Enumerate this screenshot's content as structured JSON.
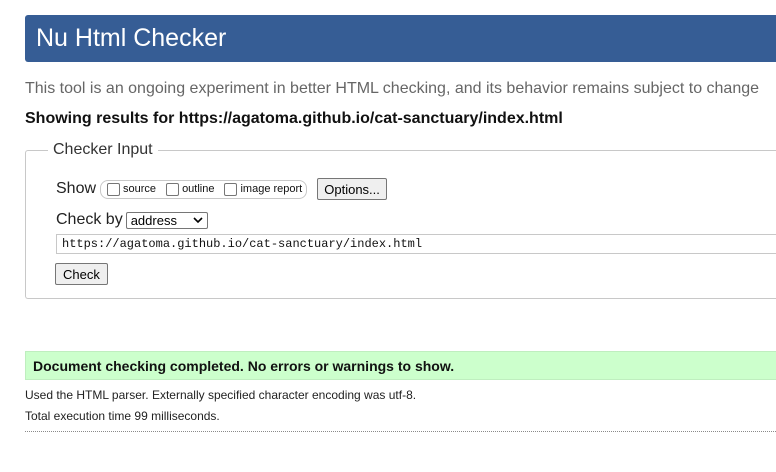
{
  "header": {
    "title": "Nu Html Checker"
  },
  "tagline": "This tool is an ongoing experiment in better HTML checking, and its behavior remains subject to change",
  "results_heading": "Showing results for https://agatoma.github.io/cat-sanctuary/index.html",
  "checker_input": {
    "legend": "Checker Input",
    "show_label": "Show",
    "show_options": [
      {
        "label": "source",
        "checked": false
      },
      {
        "label": "outline",
        "checked": false
      },
      {
        "label": "image report",
        "checked": false
      }
    ],
    "options_button": "Options...",
    "check_by_label": "Check by",
    "check_by_value": "address",
    "url_value": "https://agatoma.github.io/cat-sanctuary/index.html",
    "check_button": "Check"
  },
  "result": {
    "success_message": "Document checking completed. No errors or warnings to show.",
    "parser_info": "Used the HTML parser. Externally specified character encoding was utf-8.",
    "execution_time": "Total execution time 99 milliseconds."
  },
  "colors": {
    "header_bg": "#365d95",
    "success_bg": "#ccffcc"
  }
}
